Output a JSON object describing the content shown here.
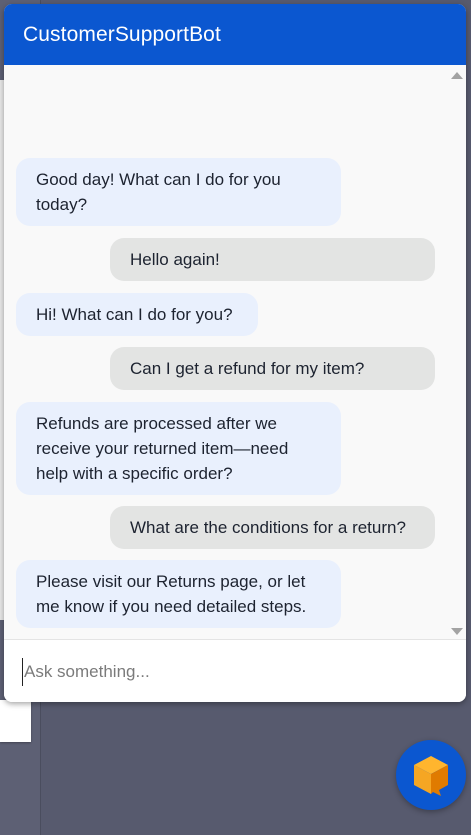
{
  "header": {
    "title": "CustomerSupportBot"
  },
  "messages": [
    {
      "role": "bot",
      "text": "Good day! What can I do for you today?"
    },
    {
      "role": "user",
      "text": "Hello again!"
    },
    {
      "role": "bot",
      "text": "Hi! What can I do for you?"
    },
    {
      "role": "user",
      "text": "Can I get a refund for my item?"
    },
    {
      "role": "bot",
      "text": "Refunds are processed after we receive your returned item—need help with a specific order?"
    },
    {
      "role": "user",
      "text": "What are the conditions for a return?"
    },
    {
      "role": "bot",
      "text": "Please visit our Returns page, or let me know if you need detailed steps."
    }
  ],
  "input": {
    "placeholder": "Ask something...",
    "value": ""
  },
  "colors": {
    "header": "#0b57d0",
    "bot_bubble": "#e9f0fd",
    "user_bubble": "#e3e4e3",
    "launcher": "#0b57d0",
    "launcher_icon": "#f5a623"
  },
  "icons": {
    "launcher": "chat-cube-icon",
    "scroll_up": "triangle-up-icon",
    "scroll_down": "triangle-down-icon"
  }
}
